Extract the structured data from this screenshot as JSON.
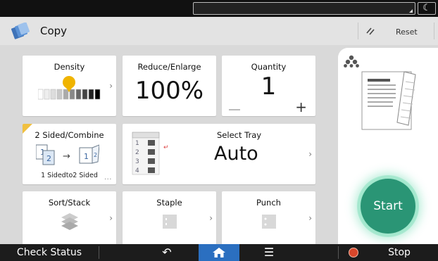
{
  "header": {
    "title": "Copy",
    "reset_label": "Reset"
  },
  "tiles": {
    "density": {
      "title": "Density",
      "level_fraction": 0.45
    },
    "reduce": {
      "title": "Reduce/Enlarge",
      "value": "100%"
    },
    "quantity": {
      "title": "Quantity",
      "value": "1"
    },
    "sided": {
      "title": "2 Sided/Combine",
      "subtitle": "1 Sidedto2 Sided",
      "page_a": "1",
      "page_b": "2",
      "page_c": "1",
      "page_d": "2"
    },
    "tray": {
      "title": "Select Tray",
      "value": "Auto",
      "tray_numbers": [
        "1",
        "2",
        "3",
        "4"
      ]
    },
    "sort": {
      "title": "Sort/Stack"
    },
    "staple": {
      "title": "Staple"
    },
    "punch": {
      "title": "Punch"
    }
  },
  "start_label": "Start",
  "bottombar": {
    "check_status": "Check Status",
    "stop": "Stop"
  },
  "colors": {
    "start": "#2a9575",
    "home": "#2b6fc0",
    "density_marker": "#f0b400",
    "accent_corner": "#f0c040",
    "stop_icon": "#d9472b"
  }
}
